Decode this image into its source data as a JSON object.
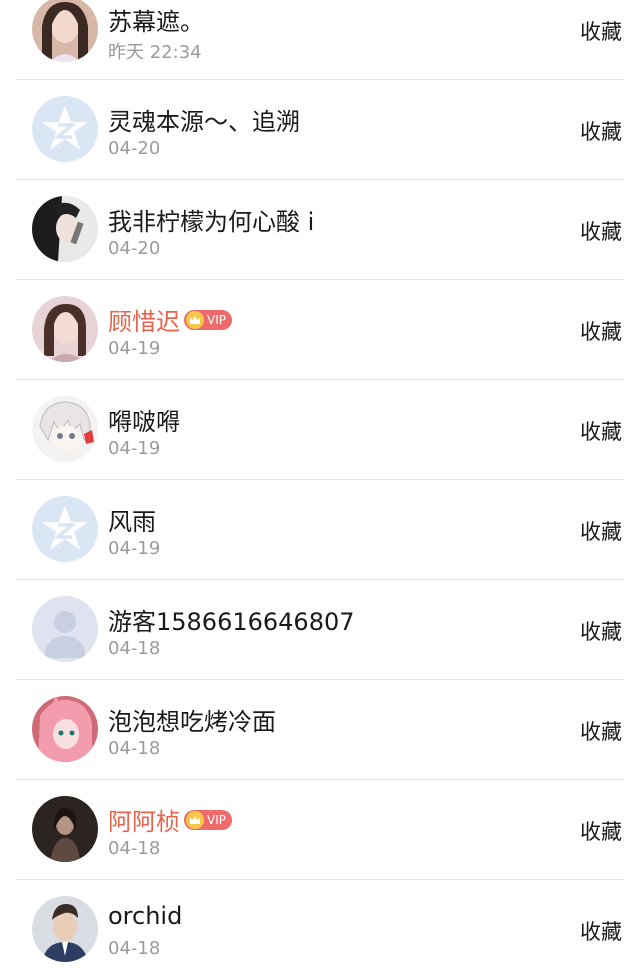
{
  "favorite_label": "收藏",
  "vip_label": "VIP",
  "items": [
    {
      "name": "苏幕遮。",
      "date": "昨天 22:34",
      "avatar": "photo-woman-1"
    },
    {
      "name": "灵魂本源～、追溯",
      "date": "04-20",
      "avatar": "default-qq-icon"
    },
    {
      "name": "我非柠檬为何心酸 i",
      "date": "04-20",
      "avatar": "photo-woman-2"
    },
    {
      "name": "顾惜迟",
      "date": "04-19",
      "avatar": "photo-woman-3",
      "vip": true
    },
    {
      "name": "嘚啵嘚",
      "date": "04-19",
      "avatar": "anime-avatar"
    },
    {
      "name": "风雨",
      "date": "04-19",
      "avatar": "default-qq-icon"
    },
    {
      "name": "游客1586616646807",
      "date": "04-18",
      "avatar": "default-person-icon"
    },
    {
      "name": "泡泡想吃烤冷面",
      "date": "04-18",
      "avatar": "anime-pink-avatar"
    },
    {
      "name": "阿阿桢",
      "date": "04-18",
      "avatar": "photo-woman-4",
      "vip": true
    },
    {
      "name": "orchid",
      "date": "04-18",
      "avatar": "photo-man"
    }
  ],
  "colors": {
    "vip_name": "#e8634c",
    "date": "#9b9b9b",
    "divider": "#e6e6e6"
  }
}
